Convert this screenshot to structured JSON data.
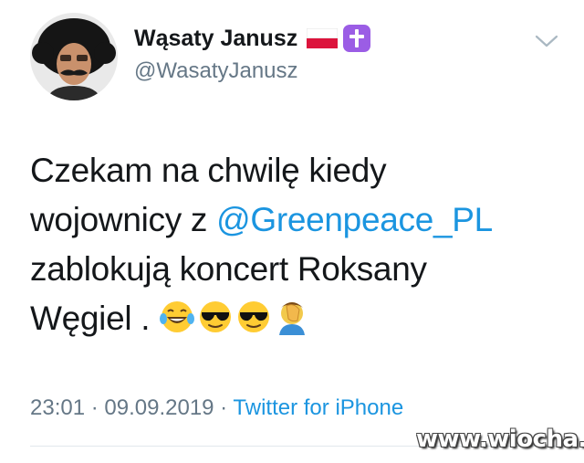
{
  "user": {
    "name": "Wąsaty Janusz",
    "handle": "@WasatyJanusz",
    "avatar_icon": "profile-avatar-mustache-afro",
    "badges": [
      "poland-flag-icon",
      "latin-cross-icon"
    ]
  },
  "menu": {
    "icon": "chevron-down-icon"
  },
  "tweet": {
    "line1": "Czekam na chwilę kiedy",
    "line2_prefix": "wojownicy z ",
    "mention": "@Greenpeace_PL",
    "line3": "zablokują koncert Roksany",
    "line4": "Węgiel . ",
    "emojis": [
      "laughing-tears-emoji",
      "sunglasses-emoji",
      "sunglasses-emoji",
      "facepalm-emoji"
    ]
  },
  "meta": {
    "time": "23:01",
    "sep1": " · ",
    "date": "09.09.2019",
    "sep2": " · ",
    "source": "Twitter for iPhone"
  },
  "watermark": "www.wiocha.pl",
  "colors": {
    "link": "#1b95e0",
    "muted": "#657786",
    "text": "#14171a",
    "badge": "#9b5de5"
  }
}
